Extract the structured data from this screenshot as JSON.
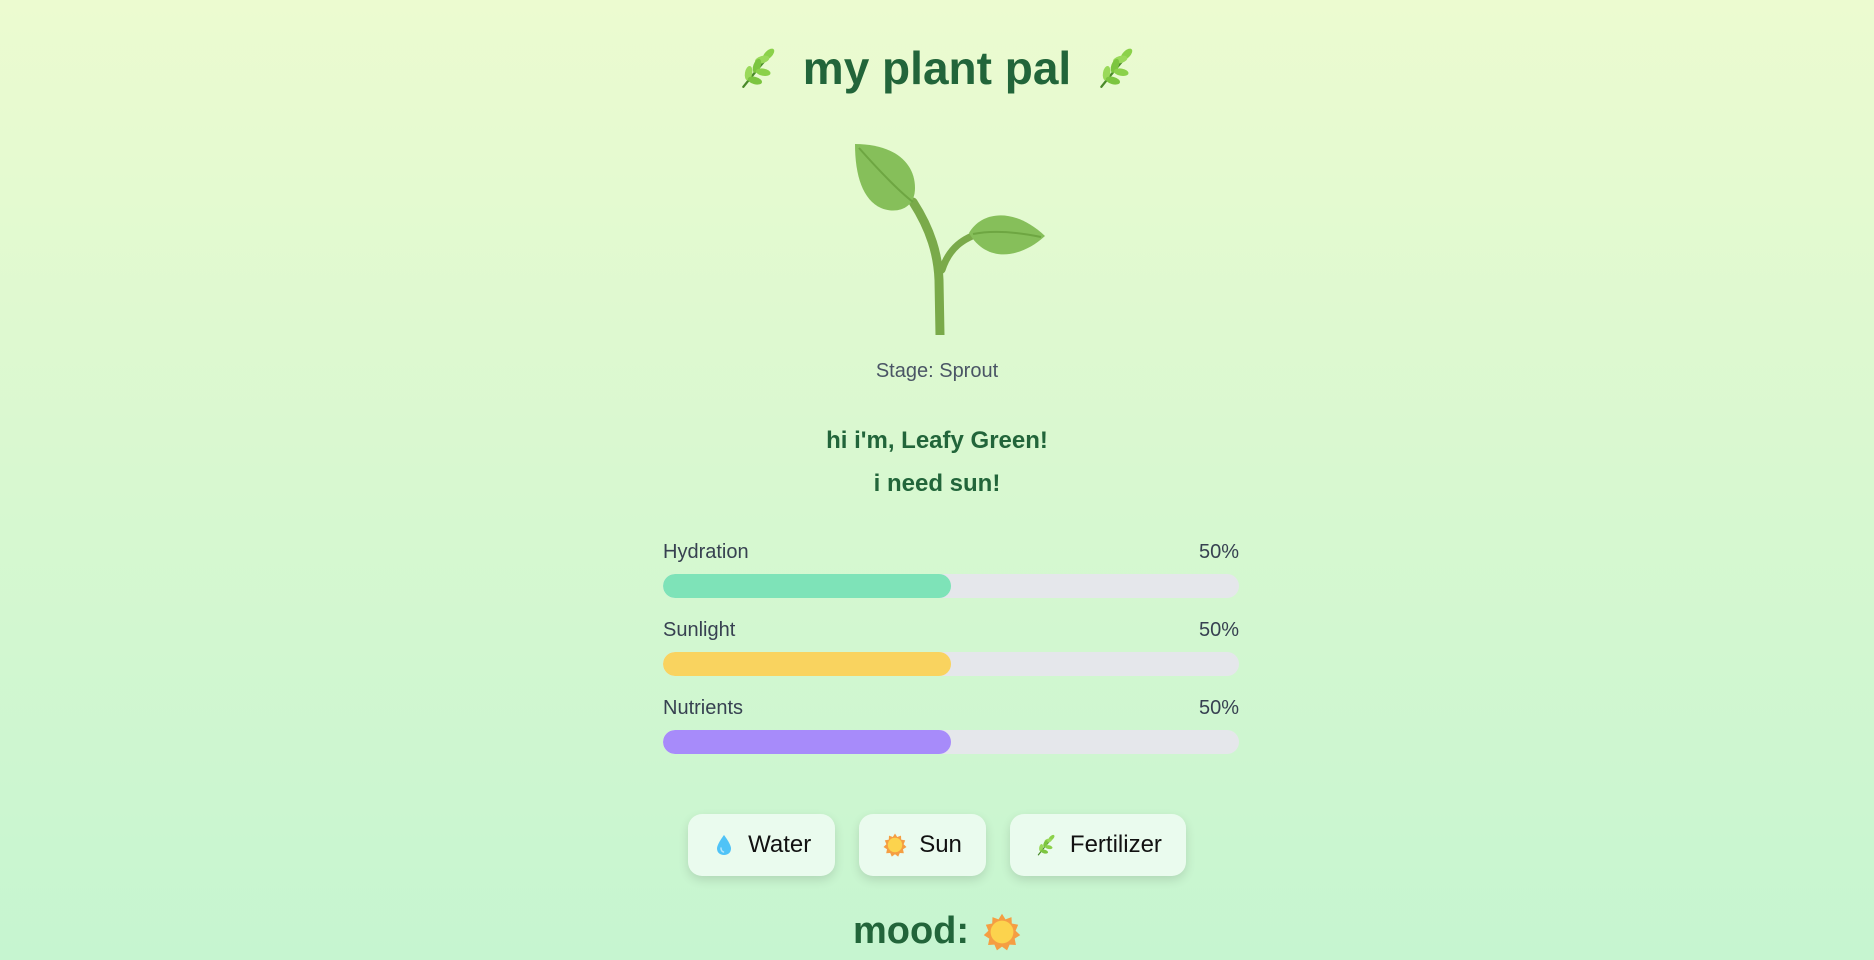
{
  "app": {
    "title": "my plant pal",
    "title_icon": "herb-icon"
  },
  "plant": {
    "icon": "seedling-icon",
    "stage_label": "Stage: Sprout",
    "greeting": "hi i'm, Leafy Green!",
    "need": "i need sun!"
  },
  "stats": [
    {
      "label": "Hydration",
      "value_text": "50%",
      "value": 0.5,
      "color": "#7ee3b8"
    },
    {
      "label": "Sunlight",
      "value_text": "50%",
      "value": 0.5,
      "color": "#f9d35f"
    },
    {
      "label": "Nutrients",
      "value_text": "50%",
      "value": 0.5,
      "color": "#a78bfa"
    }
  ],
  "actions": [
    {
      "label": "Water",
      "icon": "droplet-icon"
    },
    {
      "label": "Sun",
      "icon": "sun-icon"
    },
    {
      "label": "Fertilizer",
      "icon": "herb-icon"
    }
  ],
  "mood": {
    "label": "mood:",
    "icon": "sun-icon"
  },
  "colors": {
    "title": "#22653a",
    "bar_track": "#e5e7eb",
    "button_bg": "#eafbee"
  }
}
